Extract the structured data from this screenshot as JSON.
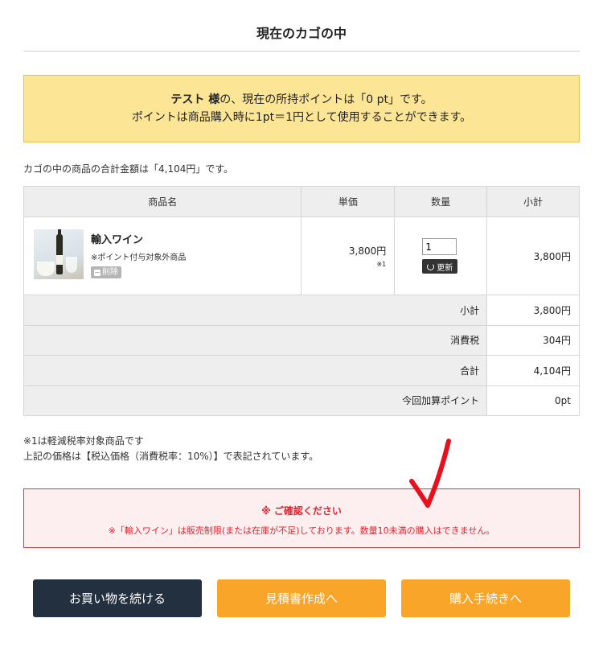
{
  "page": {
    "title": "現在のカゴの中"
  },
  "points_notice": {
    "user_name": "テスト 様",
    "line1_rest": "の、現在の所持ポイントは「0 pt」です。",
    "line2": "ポイントは商品購入時に1pt＝1円として使用することができます。"
  },
  "cart_total_text": "カゴの中の商品の合計金額は「4,104円」です。",
  "table": {
    "headers": [
      "商品名",
      "単価",
      "数量",
      "小計"
    ],
    "items": [
      {
        "name": "輸入ワイン",
        "note": "※ポイント付与対象外商品",
        "delete_label": "削除",
        "unit_price": "3,800円",
        "price_note": "※1",
        "quantity": "1",
        "update_label": "更新",
        "subtotal": "3,800円"
      }
    ],
    "summary": [
      {
        "label": "小計",
        "value": "3,800円"
      },
      {
        "label": "消費税",
        "value": "304円"
      },
      {
        "label": "合計",
        "value": "4,104円"
      },
      {
        "label": "今回加算ポイント",
        "value": "0pt"
      }
    ]
  },
  "footnote": {
    "line1": "※1は軽減税率対象商品です",
    "line2": "上記の価格は【税込価格（消費税率：10%）】で表記されています。"
  },
  "alert": {
    "title": "※ ご確認ください",
    "message": "※「輸入ワイン」は販売制限(または在庫が不足)しております。数量10未満の購入はできません。"
  },
  "buttons": {
    "continue": "お買い物を続ける",
    "quote": "見積書作成へ",
    "checkout": "購入手続きへ"
  },
  "colors": {
    "notice_bg": "#fde596",
    "alert_red": "#e2232f",
    "dark_button": "#23303f",
    "orange_button": "#f9a52a"
  }
}
